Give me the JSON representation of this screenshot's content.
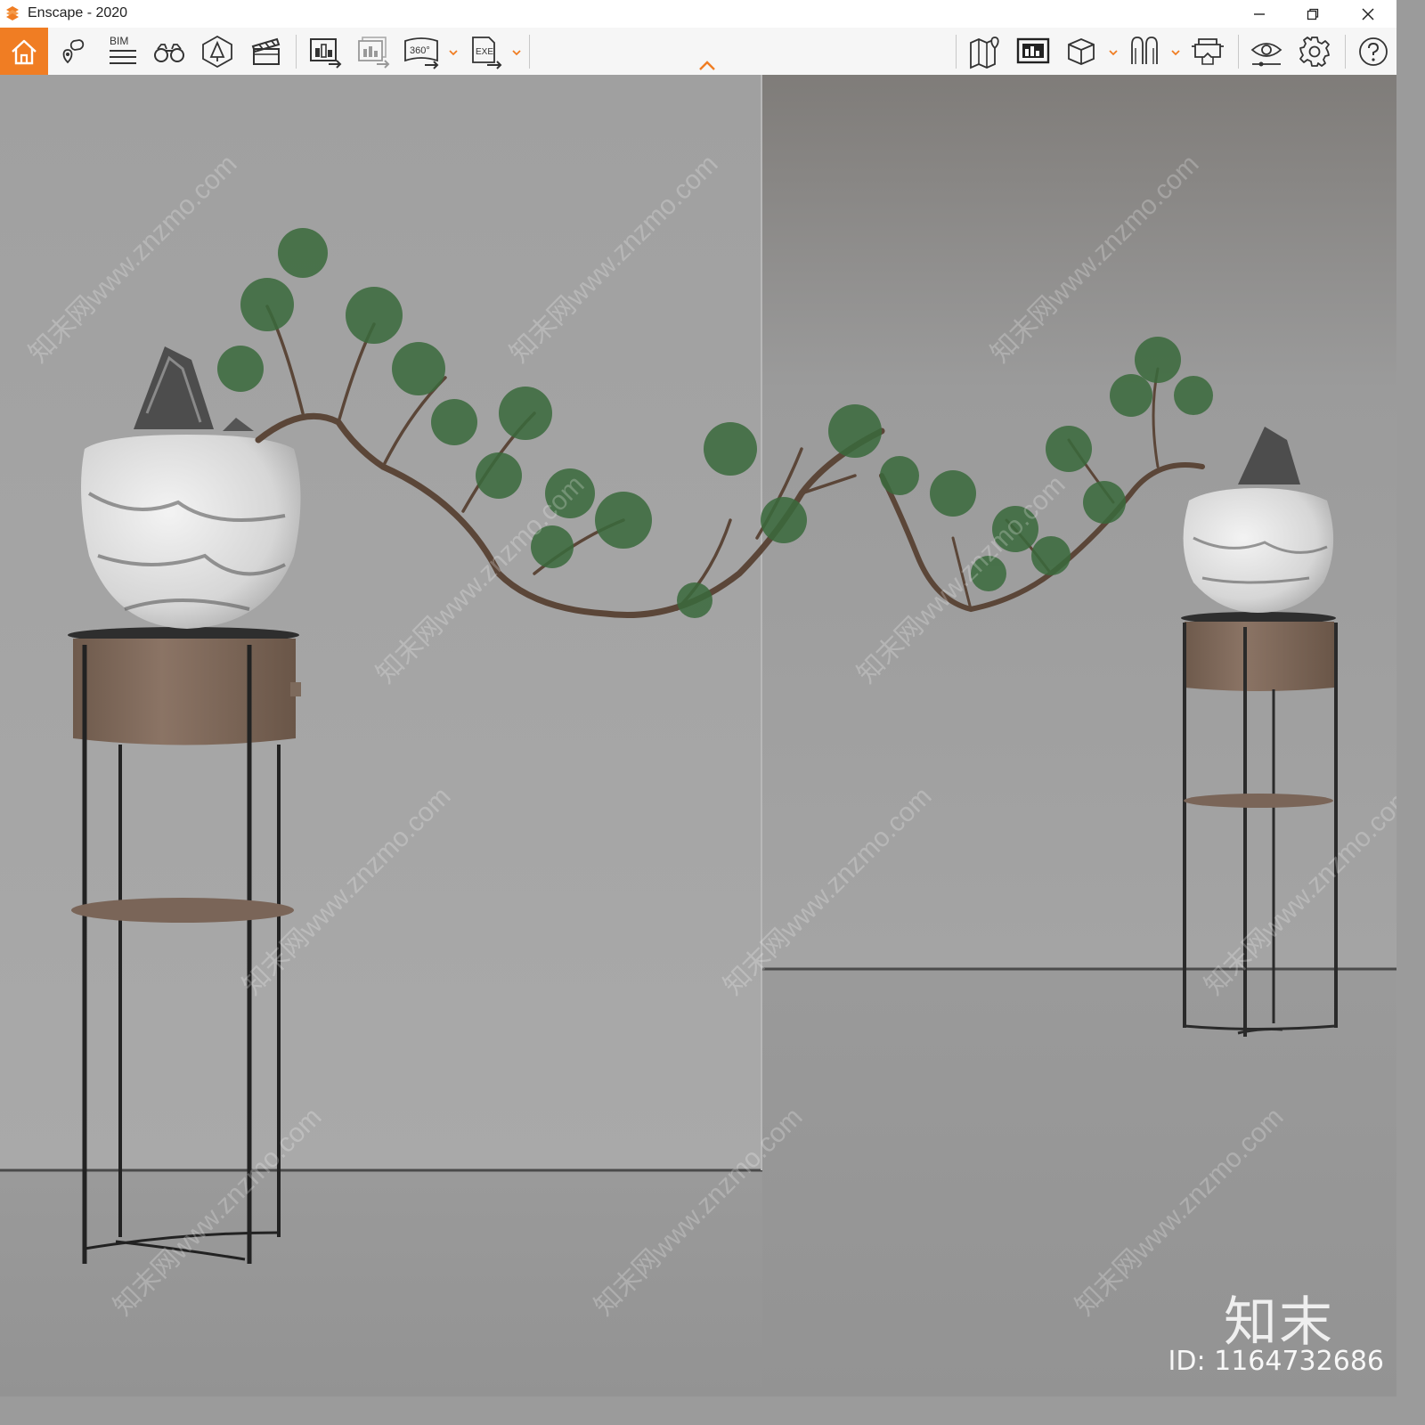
{
  "window": {
    "title": "Enscape - 2020"
  },
  "toolbar": {
    "left_buttons": [
      {
        "name": "home-icon"
      },
      {
        "name": "location-pin-icon"
      },
      {
        "name": "bim-info-icon",
        "label": "BIM"
      },
      {
        "name": "binoculars-icon"
      },
      {
        "name": "asset-library-icon"
      },
      {
        "name": "clapperboard-icon"
      },
      {
        "name": "render-screenshot-icon"
      },
      {
        "name": "batch-render-icon"
      },
      {
        "name": "panorama-360-icon",
        "label": "360°"
      },
      {
        "name": "export-exe-icon",
        "label": "EXE"
      }
    ],
    "right_buttons": [
      {
        "name": "map-icon"
      },
      {
        "name": "views-icon"
      },
      {
        "name": "cube-icon"
      },
      {
        "name": "vr-headset-icon"
      },
      {
        "name": "vr-goggles-icon"
      },
      {
        "name": "visual-settings-icon"
      },
      {
        "name": "settings-gear-icon"
      },
      {
        "name": "help-icon"
      }
    ]
  },
  "viewport": {
    "scene": "render",
    "watermark_text": "知末网www.znzmo.com",
    "brand_logo": "知末",
    "brand_id": "ID: 1164732686"
  },
  "colors": {
    "accent": "#f07d23",
    "wall": "#a2a2a2",
    "floor": "#989898"
  }
}
